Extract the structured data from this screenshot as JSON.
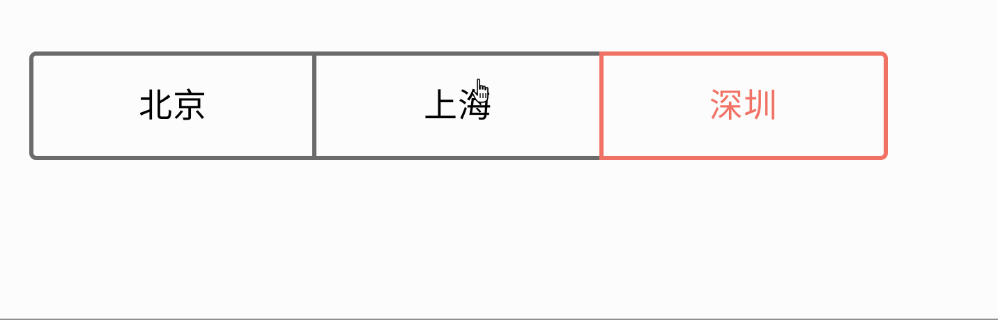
{
  "segmented_control": {
    "options": [
      {
        "label": "北京",
        "selected": false
      },
      {
        "label": "上海",
        "selected": false
      },
      {
        "label": "深圳",
        "selected": true
      }
    ],
    "colors": {
      "border_default": "#6b6b6b",
      "selected_accent": "#f07265",
      "text_default": "#000000",
      "background": "#fcfcfc"
    }
  },
  "cursor": {
    "icon": "hand-pointer-icon"
  }
}
